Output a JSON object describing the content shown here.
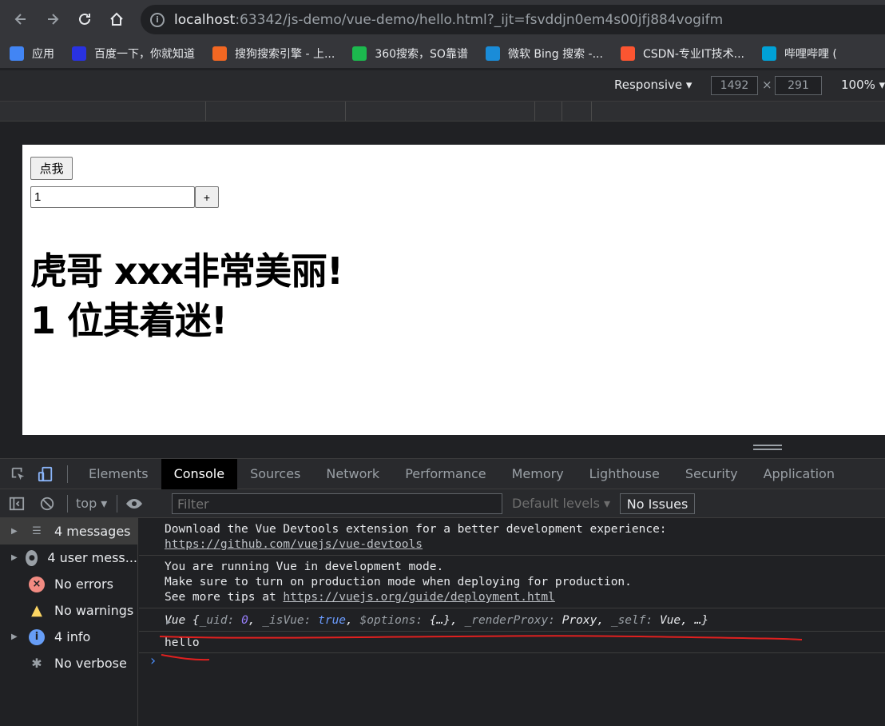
{
  "browser": {
    "url_host": "localhost",
    "url_rest": ":63342/js-demo/vue-demo/hello.html?_ijt=fsvddjn0em4s00jfj884vogifm",
    "bookmarks": [
      {
        "label": "应用",
        "icon": "apps-grid-icon",
        "color": "#4285f4"
      },
      {
        "label": "百度一下，你就知道",
        "icon": "baidu-icon",
        "color": "#2932e1"
      },
      {
        "label": "搜狗搜索引擎 - 上...",
        "icon": "sogou-icon",
        "color": "#f26722"
      },
      {
        "label": "360搜索，SO靠谱",
        "icon": "so360-icon",
        "color": "#1cb94e"
      },
      {
        "label": "微软 Bing 搜索 -...",
        "icon": "bing-icon",
        "color": "#1a8cd8"
      },
      {
        "label": "CSDN-专业IT技术...",
        "icon": "csdn-icon",
        "color": "#fc5531"
      },
      {
        "label": "哔哩哔哩 (",
        "icon": "bilibili-icon",
        "color": "#00a1d6"
      }
    ]
  },
  "device_toolbar": {
    "mode": "Responsive",
    "width": "1492",
    "height": "291",
    "times": "×",
    "zoom": "100%"
  },
  "page": {
    "button_label": "点我",
    "input_value": "1",
    "plus_label": "+",
    "line1": "虎哥 xxx非常美丽!",
    "line2": "1 位其着迷!"
  },
  "devtools": {
    "tabs": [
      "Elements",
      "Console",
      "Sources",
      "Network",
      "Performance",
      "Memory",
      "Lighthouse",
      "Security",
      "Application"
    ],
    "active_tab": "Console",
    "context": "top",
    "filter_placeholder": "Filter",
    "levels": "Default levels",
    "issues": "No Issues",
    "sidebar": [
      {
        "label": "4 messages",
        "icon": "list-icon",
        "color": "#9aa0a6",
        "expand": true
      },
      {
        "label": "4 user mess...",
        "icon": "user-icon",
        "color": "#9aa0a6",
        "expand": true
      },
      {
        "label": "No errors",
        "icon": "error-icon",
        "color": "#f28b82",
        "expand": false
      },
      {
        "label": "No warnings",
        "icon": "warning-icon",
        "color": "#fdd663",
        "expand": false
      },
      {
        "label": "4 info",
        "icon": "info-icon",
        "color": "#669df6",
        "expand": true
      },
      {
        "label": "No verbose",
        "icon": "bug-icon",
        "color": "#9aa0a6",
        "expand": false
      }
    ],
    "messages": {
      "m1_line1": "Download the Vue Devtools extension for a better development experience:",
      "m1_link": "https://github.com/vuejs/vue-devtools",
      "m2_line1": "You are running Vue in development mode.",
      "m2_line2": "Make sure to turn on production mode when deploying for production.",
      "m2_line3_prefix": "See more tips at ",
      "m2_link": "https://vuejs.org/guide/deployment.html",
      "m3_text": "hello"
    },
    "vue_object": {
      "name": "Vue",
      "uid_key": "_uid:",
      "uid_val": "0",
      "isvue_key": "_isVue:",
      "isvue_val": "true",
      "options_key": "$options:",
      "options_val": "{…}",
      "renderproxy_key": "_renderProxy:",
      "renderproxy_val": "Proxy",
      "self_key": "_self:",
      "self_val": "Vue"
    }
  }
}
